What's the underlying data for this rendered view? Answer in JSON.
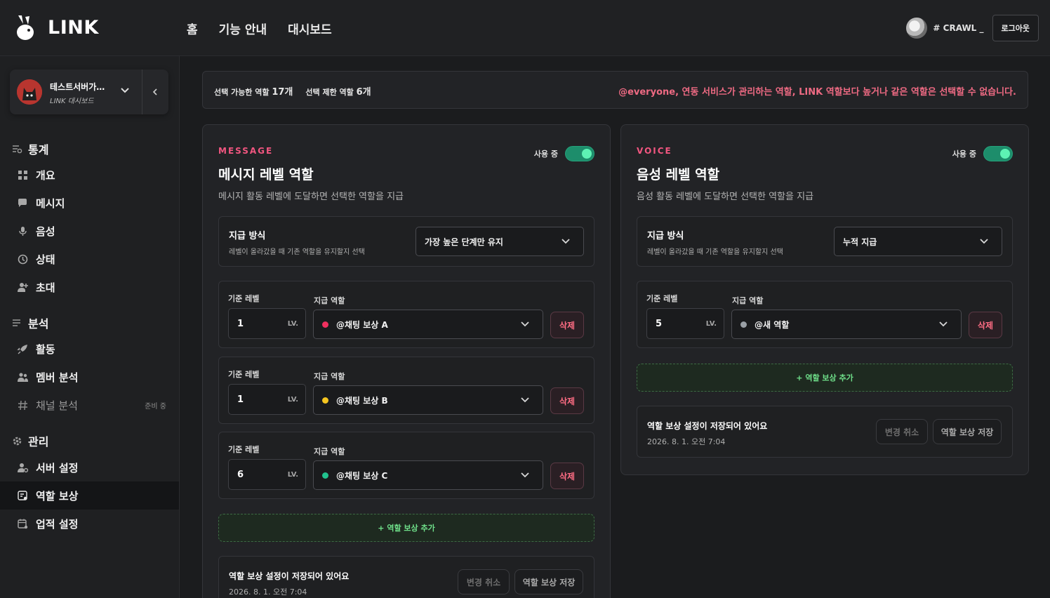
{
  "app": {
    "logo_text": "LINK"
  },
  "nav": {
    "home": "홈",
    "features": "기능 안내",
    "dashboard": "대시보드"
  },
  "user": {
    "name": "# CRAWL _",
    "logout": "로그아웃"
  },
  "server": {
    "name": "테스트서버가…",
    "subtitle": "LINK 대시보드"
  },
  "sidebar": {
    "stats_label": "통계",
    "stats_items": [
      "개요",
      "메시지",
      "음성",
      "상태",
      "초대"
    ],
    "analysis_label": "분석",
    "analysis_items": [
      "활동",
      "멤버 분석",
      "채널 분석"
    ],
    "channel_badge": "준비 중",
    "manage_label": "관리",
    "manage_items": [
      "서버 설정",
      "역할 보상",
      "업적 설정"
    ]
  },
  "info": {
    "selectable_label": "선택 가능한 역할",
    "selectable_count": "17개",
    "restricted_label": "선택 제한 역할",
    "restricted_count": "6개",
    "notice": "@everyone, 연동 서비스가 관리하는 역할, LINK 역할보다 높거나 같은 역할은 선택할 수 없습니다."
  },
  "message": {
    "eyebrow": "MESSAGE",
    "title": "메시지 레벨 역할",
    "description": "메시지 활동 레벨에 도달하면 선택한 역할을 지급",
    "toggle_label": "사용 중",
    "grant_title": "지급 방식",
    "grant_desc": "레벨이 올라갔을 때 기존 역할을 유지할지 선택",
    "grant_value": "가장 높은 단계만 유지",
    "level_label": "기준 레벨",
    "role_label": "지급 역할",
    "unit": "LV.",
    "delete": "삭제",
    "rules": [
      {
        "level": "1",
        "role": "@채팅 보상 A",
        "color": "#f0305f"
      },
      {
        "level": "1",
        "role": "@채팅 보상 B",
        "color": "#f5c520"
      },
      {
        "level": "6",
        "role": "@채팅 보상 C",
        "color": "#21c28e"
      }
    ],
    "add": "+ 역할 보상 추가",
    "save_title": "역할 보상 설정이 저장되어 있어요",
    "save_time": "2026. 8. 1. 오전 7:04",
    "cancel": "변경 취소",
    "save": "역할 보상 저장"
  },
  "voice": {
    "eyebrow": "VOICE",
    "title": "음성 레벨 역할",
    "description": "음성 활동 레벨에 도달하면 선택한 역할을 지급",
    "toggle_label": "사용 중",
    "grant_title": "지급 방식",
    "grant_desc": "레벨이 올라갔을 때 기존 역할을 유지할지 선택",
    "grant_value": "누적 지급",
    "level_label": "기준 레벨",
    "role_label": "지급 역할",
    "unit": "LV.",
    "delete": "삭제",
    "rules": [
      {
        "level": "5",
        "role": "@새 역할",
        "color": "#9aa0a6"
      }
    ],
    "add": "+ 역할 보상 추가",
    "save_title": "역할 보상 설정이 저장되어 있어요",
    "save_time": "2026. 8. 1. 오전 7:04",
    "cancel": "변경 취소",
    "save": "역할 보상 저장"
  }
}
